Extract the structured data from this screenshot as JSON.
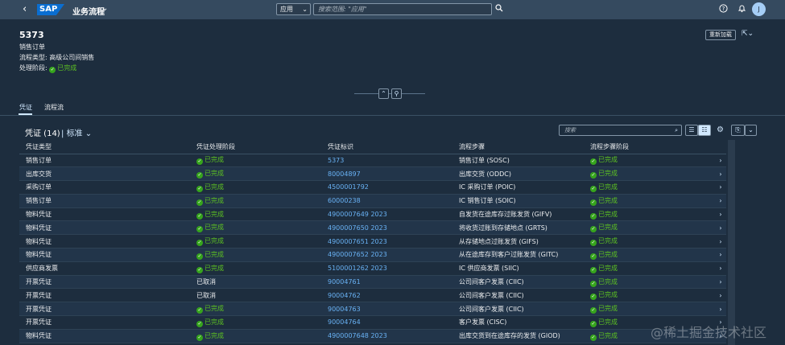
{
  "shell": {
    "back_glyph": "‹",
    "logo": "SAP",
    "title": "业务流程",
    "scope_label": "应用",
    "search_placeholder": "搜索范围: \"应用\"",
    "avatar_initial": "J"
  },
  "header": {
    "title": "5373",
    "subtitle": "销售订单",
    "process_type_label": "流程类型:",
    "process_type_value": "高级公司间销售",
    "stage_label": "处理阶段:",
    "stage_value": "已完成",
    "reload_label": "重新加载"
  },
  "tabs": [
    {
      "label": "凭证"
    },
    {
      "label": "流程流"
    }
  ],
  "table": {
    "title": "凭证 (14)",
    "variant": "标准",
    "search_placeholder": "搜索",
    "columns": [
      "凭证类型",
      "",
      "凭证处理阶段",
      "凭证标识",
      "流程步骤",
      "流程步骤阶段",
      ""
    ],
    "rows": [
      {
        "type": "销售订单",
        "stage": "已完成",
        "stage_ok": true,
        "id": "5373",
        "step": "销售订单 (SOSC)",
        "step_stage": "已完成"
      },
      {
        "type": "出库交货",
        "stage": "已完成",
        "stage_ok": true,
        "id": "80004897",
        "step": "出库交货 (ODDC)",
        "step_stage": "已完成"
      },
      {
        "type": "采购订单",
        "stage": "已完成",
        "stage_ok": true,
        "id": "4500001792",
        "step": "IC 采购订单 (POIC)",
        "step_stage": "已完成"
      },
      {
        "type": "销售订单",
        "stage": "已完成",
        "stage_ok": true,
        "id": "60000238",
        "step": "IC 销售订单 (SOIC)",
        "step_stage": "已完成"
      },
      {
        "type": "物料凭证",
        "stage": "已完成",
        "stage_ok": true,
        "id": "4900007649 2023",
        "step": "自发货在途库存过账发货 (GIFV)",
        "step_stage": "已完成"
      },
      {
        "type": "物料凭证",
        "stage": "已完成",
        "stage_ok": true,
        "id": "4900007650 2023",
        "step": "将收货过账到存储地点 (GRTS)",
        "step_stage": "已完成"
      },
      {
        "type": "物料凭证",
        "stage": "已完成",
        "stage_ok": true,
        "id": "4900007651 2023",
        "step": "从存储地点过账发货 (GIFS)",
        "step_stage": "已完成"
      },
      {
        "type": "物料凭证",
        "stage": "已完成",
        "stage_ok": true,
        "id": "4900007652 2023",
        "step": "从在途库存到客户过账发货 (GITC)",
        "step_stage": "已完成"
      },
      {
        "type": "供应商发票",
        "stage": "已完成",
        "stage_ok": true,
        "id": "5100001262 2023",
        "step": "IC 供应商发票 (SIIC)",
        "step_stage": "已完成"
      },
      {
        "type": "开票凭证",
        "stage": "已取消",
        "stage_ok": false,
        "id": "90004761",
        "step": "公司间客户发票 (CIIC)",
        "step_stage": "已完成"
      },
      {
        "type": "开票凭证",
        "stage": "已取消",
        "stage_ok": false,
        "id": "90004762",
        "step": "公司间客户发票 (CIIC)",
        "step_stage": "已完成"
      },
      {
        "type": "开票凭证",
        "stage": "已完成",
        "stage_ok": true,
        "id": "90004763",
        "step": "公司间客户发票 (CIIC)",
        "step_stage": "已完成"
      },
      {
        "type": "开票凭证",
        "stage": "已完成",
        "stage_ok": true,
        "id": "90004764",
        "step": "客户发票 (CISC)",
        "step_stage": "已完成"
      },
      {
        "type": "物料凭证",
        "stage": "已完成",
        "stage_ok": true,
        "id": "4900007648 2023",
        "step": "出库交货到在途库存的发货 (GIOD)",
        "step_stage": "已完成"
      }
    ]
  },
  "watermark": "@稀土掘金技术社区",
  "colors": {
    "success": "#36a41d",
    "link": "#69b2f5",
    "shell": "#354a5f",
    "background": "#1d2d3e"
  }
}
